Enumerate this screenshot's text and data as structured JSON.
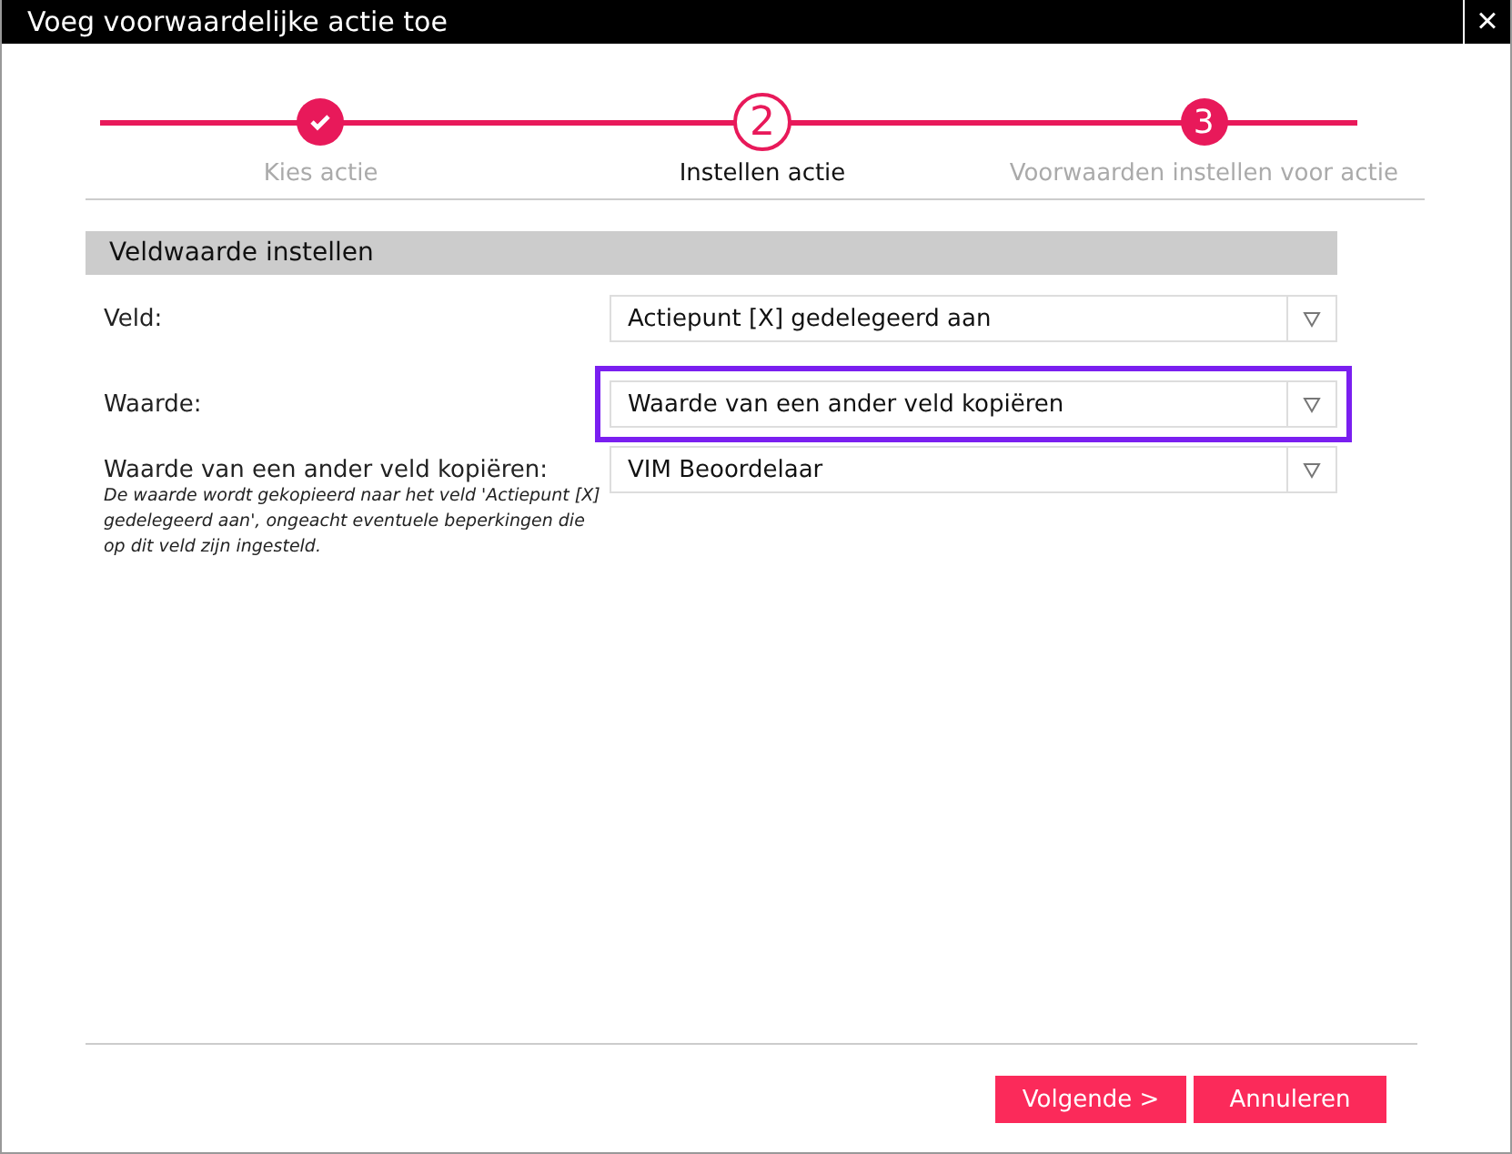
{
  "window": {
    "title": "Voeg voorwaardelijke actie toe",
    "close": "×"
  },
  "steps": [
    {
      "label": "Kies actie",
      "done": true,
      "selected": false
    },
    {
      "number": "2",
      "label": "Instellen actie",
      "done": false,
      "selected": true
    },
    {
      "number": "3",
      "label": "Voorwaarden instellen voor actie",
      "done": false,
      "selected": false
    }
  ],
  "section": {
    "title": "Veldwaarde instellen"
  },
  "fields": [
    {
      "label": "Veld:",
      "value": "Actiepunt [X] gedelegeerd aan",
      "focused": false
    },
    {
      "label": "Waarde:",
      "value": "Waarde van een ander veld kopiëren",
      "focused": true
    },
    {
      "label": "Waarde van een ander veld kopiëren:",
      "hint": "De waarde wordt gekopieerd naar het veld 'Actiepunt [X] gedelegeerd aan', ongeacht eventuele beperkingen die op dit veld zijn ingesteld.",
      "value": "VIM Beoordelaar",
      "focused": false
    }
  ],
  "buttons": [
    {
      "label": "Volgende >"
    },
    {
      "label": "Annuleren"
    }
  ]
}
